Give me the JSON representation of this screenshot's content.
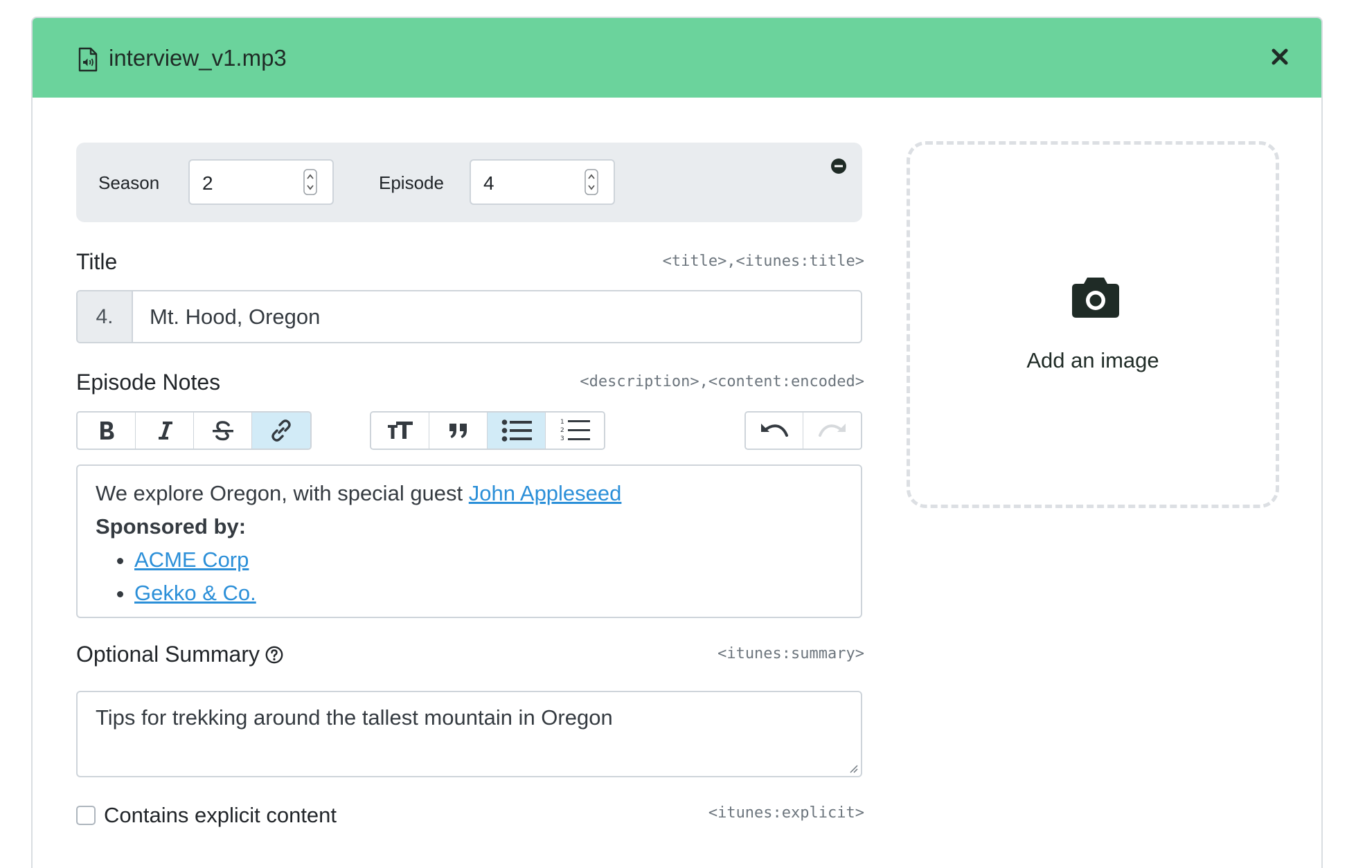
{
  "header": {
    "file_name": "interview_v1.mp3",
    "file_icon": "audio-file-icon",
    "close_icon": "close-icon"
  },
  "meta": {
    "season_label": "Season",
    "season_value": "2",
    "episode_label": "Episode",
    "episode_value": "4",
    "collapse_icon": "minus-circle-icon"
  },
  "title_field": {
    "label": "Title",
    "tag_hint": "<title>,<itunes:title>",
    "prefix": "4.",
    "value": "Mt. Hood, Oregon"
  },
  "notes_field": {
    "label": "Episode Notes",
    "tag_hint": "<description>,<content:encoded>",
    "toolbar": [
      {
        "name": "bold",
        "icon": "bold-icon",
        "active": false
      },
      {
        "name": "italic",
        "icon": "italic-icon",
        "active": false
      },
      {
        "name": "strikethrough",
        "icon": "strikethrough-icon",
        "active": false
      },
      {
        "name": "link",
        "icon": "link-icon",
        "active": true
      },
      {
        "name": "heading",
        "icon": "heading-icon",
        "active": false
      },
      {
        "name": "quote",
        "icon": "quote-icon",
        "active": false
      },
      {
        "name": "bullet-list",
        "icon": "bullet-list-icon",
        "active": true
      },
      {
        "name": "numbered-list",
        "icon": "numbered-list-icon",
        "active": false
      },
      {
        "name": "undo",
        "icon": "undo-icon",
        "active": false
      },
      {
        "name": "redo",
        "icon": "redo-icon",
        "active": false
      }
    ],
    "content": {
      "intro": "We explore Oregon, with special guest ",
      "guest_link": "John Appleseed",
      "sponsored_heading": "Sponsored by:",
      "sponsors": [
        "ACME Corp",
        "Gekko & Co."
      ]
    }
  },
  "summary_field": {
    "label": "Optional Summary",
    "help_icon": "question-circle-icon",
    "tag_hint": "<itunes:summary>",
    "value": "Tips for trekking around the tallest mountain in Oregon"
  },
  "explicit_field": {
    "label": "Contains explicit content",
    "tag_hint": "<itunes:explicit>",
    "checked": false
  },
  "image_dropzone": {
    "icon": "camera-icon",
    "text": "Add an image"
  },
  "colors": {
    "header_bg": "#6bd39c",
    "link": "#2b8fd8",
    "active_button": "#d2ebf7",
    "panel_bg": "#e9ecef"
  }
}
